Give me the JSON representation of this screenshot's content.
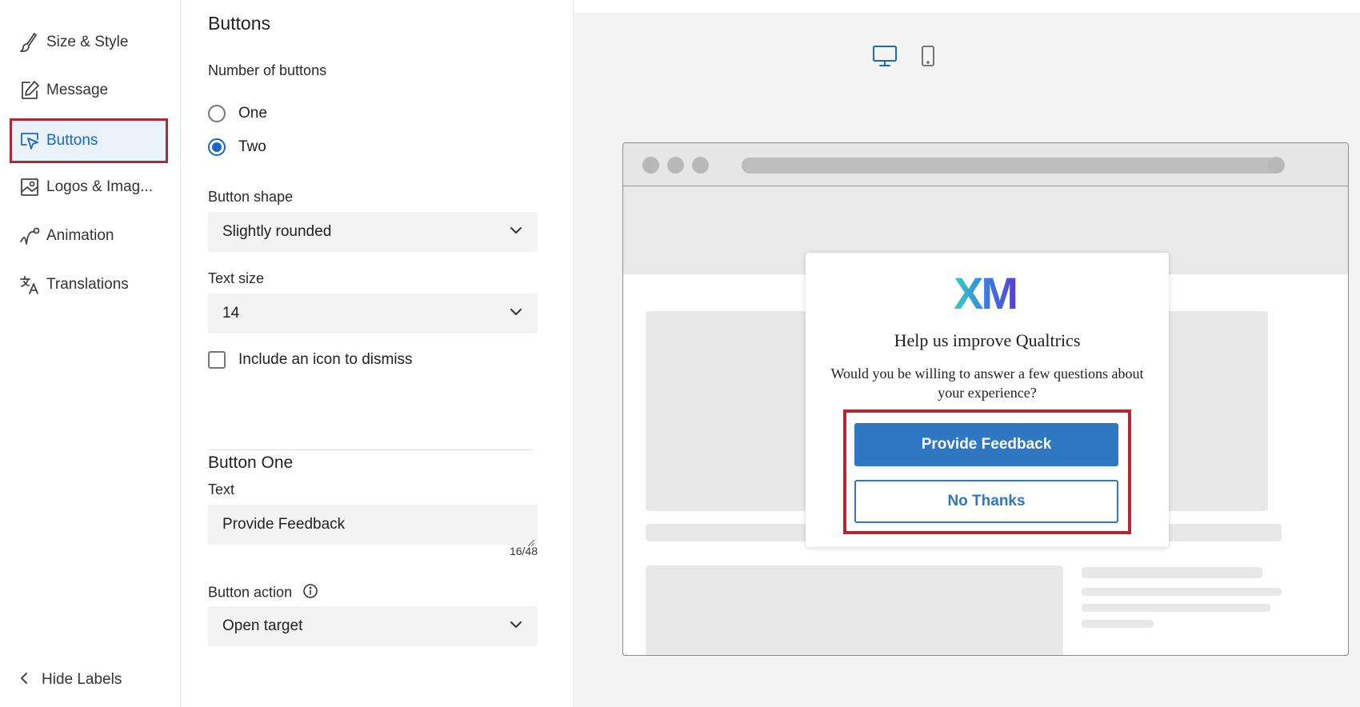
{
  "nav": {
    "items": [
      {
        "label": "Size & Style",
        "icon": "brush-icon"
      },
      {
        "label": "Message",
        "icon": "edit-icon"
      },
      {
        "label": "Buttons",
        "icon": "cursor-click-icon",
        "active": true
      },
      {
        "label": "Logos & Imag...",
        "icon": "image-icon"
      },
      {
        "label": "Animation",
        "icon": "animation-curve-icon"
      },
      {
        "label": "Translations",
        "icon": "translate-icon"
      }
    ],
    "hide_labels": "Hide Labels"
  },
  "panel": {
    "title": "Buttons",
    "number_of_buttons": {
      "label": "Number of buttons",
      "options": [
        "One",
        "Two"
      ],
      "selected": "Two"
    },
    "button_shape": {
      "label": "Button shape",
      "value": "Slightly rounded"
    },
    "text_size": {
      "label": "Text size",
      "value": "14"
    },
    "dismiss_icon": {
      "label": "Include an icon to dismiss",
      "checked": false
    },
    "button_one": {
      "title": "Button One",
      "text_label": "Text",
      "text_value": "Provide Feedback",
      "counter": "16/48",
      "action_label": "Button action",
      "action_value": "Open target"
    }
  },
  "preview": {
    "device": "desktop",
    "card": {
      "logo_text": "XM",
      "title": "Help us improve Qualtrics",
      "message": "Would you be willing to answer a few questions about your experience?",
      "primary_button": "Provide Feedback",
      "secondary_button": "No Thanks"
    }
  },
  "colors": {
    "accent": "#1b66c9",
    "button_blue": "#2f77c1",
    "highlight_red": "#ad2a35"
  }
}
